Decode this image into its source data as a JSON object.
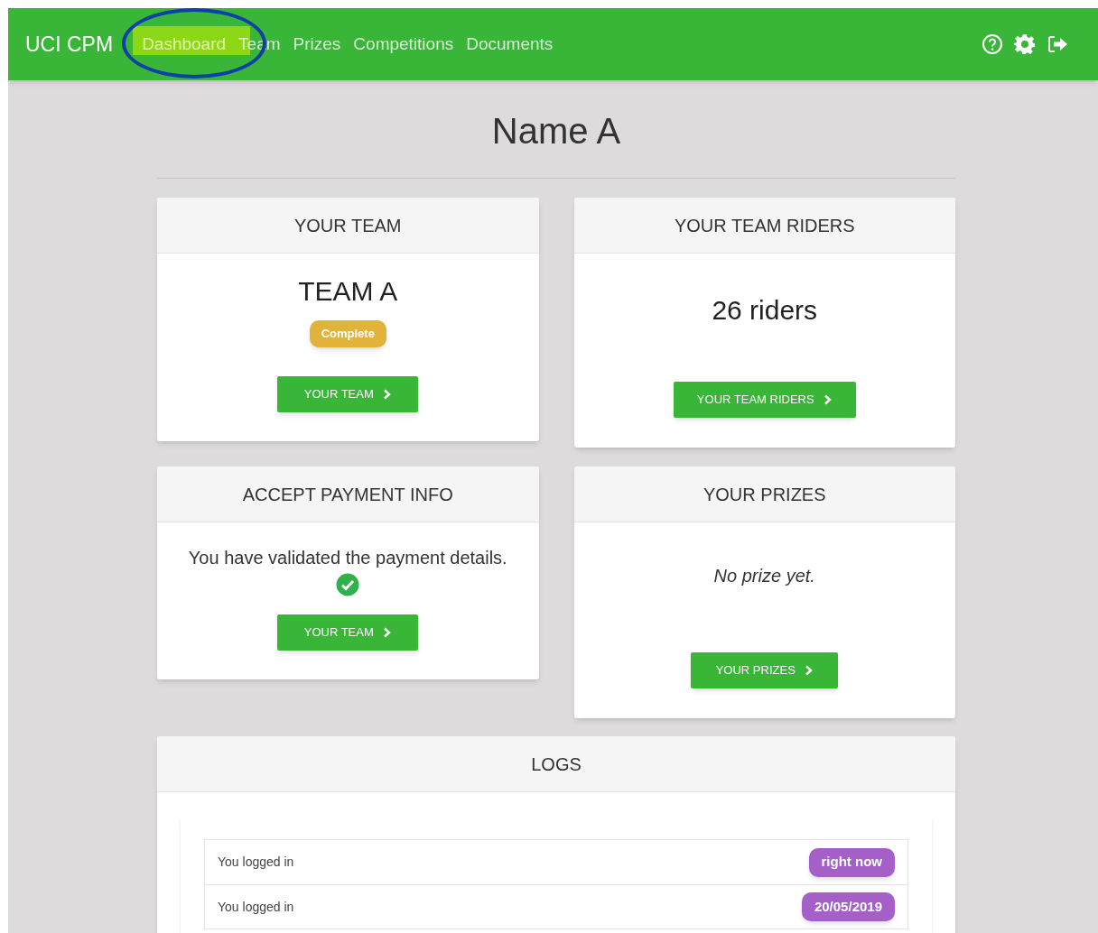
{
  "app": {
    "brand": "UCI CPM"
  },
  "nav": [
    {
      "label": "Dashboard",
      "highlighted": true
    },
    {
      "label": "Team",
      "highlighted": false
    },
    {
      "label": "Prizes",
      "highlighted": false
    },
    {
      "label": "Competitions",
      "highlighted": false
    },
    {
      "label": "Documents",
      "highlighted": false
    }
  ],
  "page_title": "Name A",
  "cards": [
    {
      "kind": "team",
      "title": "YOUR TEAM",
      "heading": "TEAM A",
      "badge": "Complete",
      "button": "YOUR TEAM"
    },
    {
      "kind": "riders",
      "title": "YOUR TEAM RIDERS",
      "heading": "26 riders",
      "button": "YOUR TEAM RIDERS"
    },
    {
      "kind": "payment",
      "title": "ACCEPT PAYMENT INFO",
      "message": "You have validated the payment details.",
      "button": "YOUR TEAM"
    },
    {
      "kind": "prizes",
      "title": "YOUR PRIZES",
      "message": "No prize yet.",
      "button": "YOUR PRIZES"
    }
  ],
  "logs": {
    "title": "LOGS",
    "rows": [
      {
        "text": "You logged in",
        "time": "right now"
      },
      {
        "text": "You logged in",
        "time": "20/05/2019"
      }
    ]
  }
}
